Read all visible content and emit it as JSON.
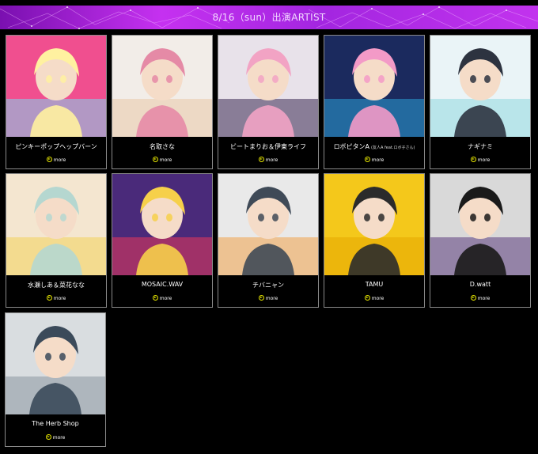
{
  "header": {
    "title": "8/16（sun）出演ARTIST"
  },
  "more_label": "more",
  "artists": [
    {
      "name": "ピンキーポップヘップバーン",
      "sub": "",
      "palette": [
        "#f04f8f",
        "#7fd6f0",
        "#fff1a0"
      ]
    },
    {
      "name": "名取さな",
      "sub": "",
      "palette": [
        "#f2ede8",
        "#e9c9a8",
        "#e58aa6"
      ]
    },
    {
      "name": "ビートまりお＆伊東ライフ",
      "sub": "",
      "palette": [
        "#e8e2ea",
        "#3a2a52",
        "#f2a3c4"
      ]
    },
    {
      "name": "ロボピタンA",
      "sub": "(友人A feat.ロボ子さん)",
      "palette": [
        "#1b2a5e",
        "#2a9fd6",
        "#f39ac7"
      ]
    },
    {
      "name": "ナギナミ",
      "sub": "",
      "palette": [
        "#eaf4f7",
        "#8fd9e0",
        "#2d3340"
      ]
    },
    {
      "name": "水瀬しあ＆菜花なな",
      "sub": "",
      "palette": [
        "#f4e6d0",
        "#f3d25a",
        "#b5d7d0"
      ]
    },
    {
      "name": "MOSAIC.WAV",
      "sub": "",
      "palette": [
        "#4a2a7a",
        "#e8375a",
        "#f6d04a"
      ]
    },
    {
      "name": "チバニャン",
      "sub": "",
      "palette": [
        "#e9e9e9",
        "#f0a34a",
        "#3f4a57"
      ]
    },
    {
      "name": "TAMU",
      "sub": "",
      "palette": [
        "#f4c81b",
        "#e6a800",
        "#2b2b2b"
      ]
    },
    {
      "name": "D.watt",
      "sub": "",
      "palette": [
        "#d9d9d9",
        "#5b3c7e",
        "#1a1a1a"
      ]
    },
    {
      "name": "The Herb Shop",
      "sub": "",
      "palette": [
        "#d9dde0",
        "#8a95a0",
        "#3b4a5a"
      ]
    }
  ]
}
